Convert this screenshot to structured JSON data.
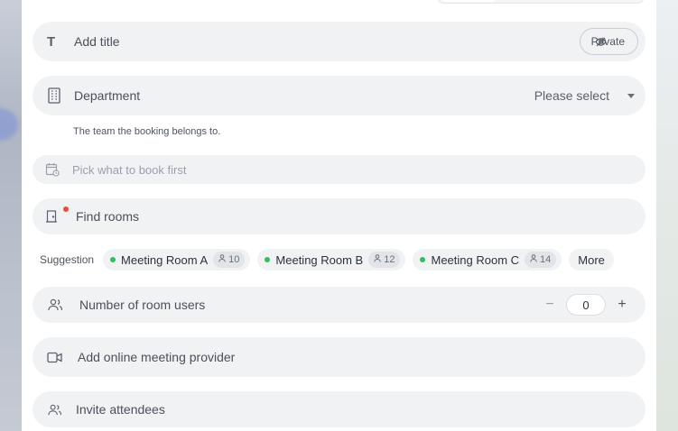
{
  "title_row": {
    "placeholder": "Add title",
    "icon": "text-icon",
    "private_label": "Private"
  },
  "department": {
    "label": "Department",
    "select_value": "Please select",
    "help": "The team the booking belongs to."
  },
  "pick": {
    "placeholder": "Pick what to book first"
  },
  "find_rooms": {
    "placeholder": "Find rooms"
  },
  "suggestions": {
    "label": "Suggestion",
    "rooms": [
      {
        "name": "Meeting Room A",
        "capacity": "10"
      },
      {
        "name": "Meeting Room B",
        "capacity": "12"
      },
      {
        "name": "Meeting Room C",
        "capacity": "14"
      }
    ],
    "more_label": "More",
    "status_color": "#2fbf5d"
  },
  "users": {
    "label": "Number of room users",
    "minus": "−",
    "value": "0",
    "plus": "+"
  },
  "online": {
    "label": "Add online meeting provider"
  },
  "invite": {
    "label": "Invite attendees"
  },
  "colors": {
    "row_bg": "#f1f2f4",
    "alert_dot": "#e84b3c"
  }
}
